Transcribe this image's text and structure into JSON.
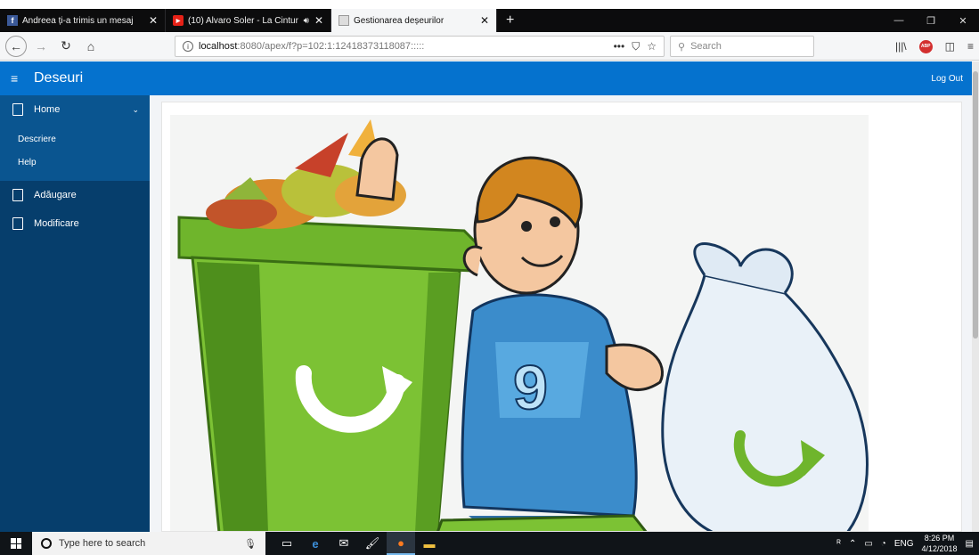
{
  "browser": {
    "tabs": [
      {
        "title": "Andreea ți-a trimis un mesaj",
        "favicon": "facebook-icon",
        "favicon_color": "#3b5998",
        "active": false
      },
      {
        "title": "(10) Alvaro Soler - La Cintur",
        "favicon": "youtube-icon",
        "favicon_color": "#e62117",
        "active": false
      },
      {
        "title": "Gestionarea deșeurilor",
        "favicon": "page-icon",
        "active": true
      }
    ],
    "new_tab_symbol": "+",
    "url_host": "localhost",
    "url_path": ":8080/apex/f?p=102:1:12418373118087:::::",
    "search_placeholder": "Search"
  },
  "app": {
    "title": "Deseuri",
    "logout_label": "Log Out",
    "header_color": "#0572ce",
    "sidebar_color": "#063e6c"
  },
  "sidebar": {
    "home_label": "Home",
    "home_subitems": [
      "Descriere",
      "Help"
    ],
    "items": [
      "Adăugare",
      "Modificare"
    ]
  },
  "main": {
    "illustration": "recycling-illustration",
    "scroll_position": 0.05
  },
  "taskbar": {
    "search_placeholder": "Type here to search",
    "apps": [
      "task-view-icon",
      "edge-icon",
      "mail-icon",
      "paint-icon",
      "firefox-icon",
      "file-explorer-icon"
    ],
    "language": "ENG",
    "time": "8:26 PM",
    "date": "4/12/2018"
  }
}
